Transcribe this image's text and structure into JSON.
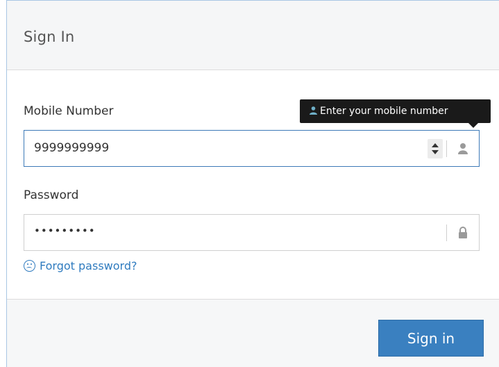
{
  "header": {
    "title": "Sign In"
  },
  "form": {
    "mobile": {
      "label": "Mobile Number",
      "value": "9999999999",
      "tooltip": "Enter your mobile number",
      "addon_icon": "user-icon"
    },
    "password": {
      "label": "Password",
      "masked_value": "•••••••••",
      "addon_icon": "lock-icon"
    },
    "forgot_link": "Forgot password?",
    "forgot_icon": "sad-face-icon"
  },
  "footer": {
    "submit_label": "Sign in"
  },
  "colors": {
    "accent": "#3a80c0",
    "link": "#2f7bbf",
    "tooltip_bg": "#1a1a1a",
    "focus_border": "#3d7ab8"
  }
}
